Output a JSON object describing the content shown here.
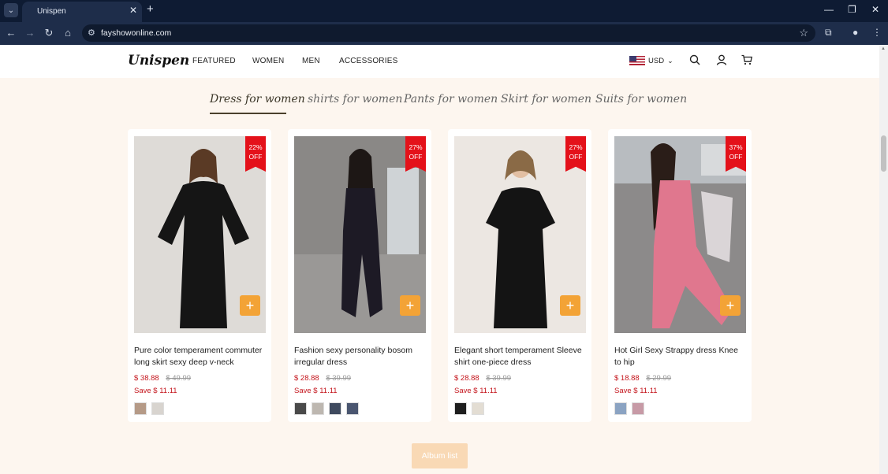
{
  "browser": {
    "tab_title": "Unispen",
    "tab_close": "✕",
    "new_tab": "+",
    "url": "fayshowonline.com",
    "window_controls": [
      "—",
      "❐",
      "✕"
    ]
  },
  "header": {
    "logo": "Unispen",
    "nav": [
      "FEATURED",
      "WOMEN",
      "MEN",
      "ACCESSORIES"
    ],
    "currency": "USD"
  },
  "categories": [
    {
      "label": "Dress for women",
      "active": true
    },
    {
      "label": "shirts for women",
      "active": false
    },
    {
      "label": "Pants for women",
      "active": false
    },
    {
      "label": "Skirt for women",
      "active": false
    },
    {
      "label": "Suits for women",
      "active": false
    }
  ],
  "products": [
    {
      "discount_pct": "22%",
      "discount_word": "OFF",
      "title": "Pure color temperament commuter long skirt sexy deep v-neck lantern…",
      "price": "$ 38.88",
      "old_price": "$ 49.99",
      "save": "Save $ 11.11",
      "swatches": [
        "#b59a87",
        "#d8d4cf"
      ],
      "image_bg": "#dedbd7",
      "dress_color": "#151515"
    },
    {
      "discount_pct": "27%",
      "discount_word": "OFF",
      "title": "Fashion sexy personality bosom irregular dress",
      "price": "$ 28.88",
      "old_price": "$ 39.99",
      "save": "Save $ 11.11",
      "swatches": [
        "#4a4a4a",
        "#bdb7b0",
        "#3f4a5e",
        "#4a5670"
      ],
      "image_bg": "#9a9896",
      "dress_color": "#1d1a25"
    },
    {
      "discount_pct": "27%",
      "discount_word": "OFF",
      "title": "Elegant short temperament Sleeve shirt one-piece dress",
      "price": "$ 28.88",
      "old_price": "$ 39.99",
      "save": "Save $ 11.11",
      "swatches": [
        "#1e1e1e",
        "#e3ddd3"
      ],
      "image_bg": "#ece7e2",
      "dress_color": "#141414"
    },
    {
      "discount_pct": "37%",
      "discount_word": "OFF",
      "title": "Hot Girl Sexy Strappy dress Knee to hip",
      "price": "$ 18.88",
      "old_price": "$ 29.99",
      "save": "Save $ 11.11",
      "swatches": [
        "#8ba3c2",
        "#c79aa6"
      ],
      "image_bg": "#8c8a8a",
      "dress_color": "#e0778e"
    }
  ],
  "album_button": "Album list",
  "colors": {
    "accent_orange": "#f3a336",
    "badge_red": "#e4111a",
    "price_red": "#c4141b",
    "page_bg": "#fdf6ef"
  }
}
